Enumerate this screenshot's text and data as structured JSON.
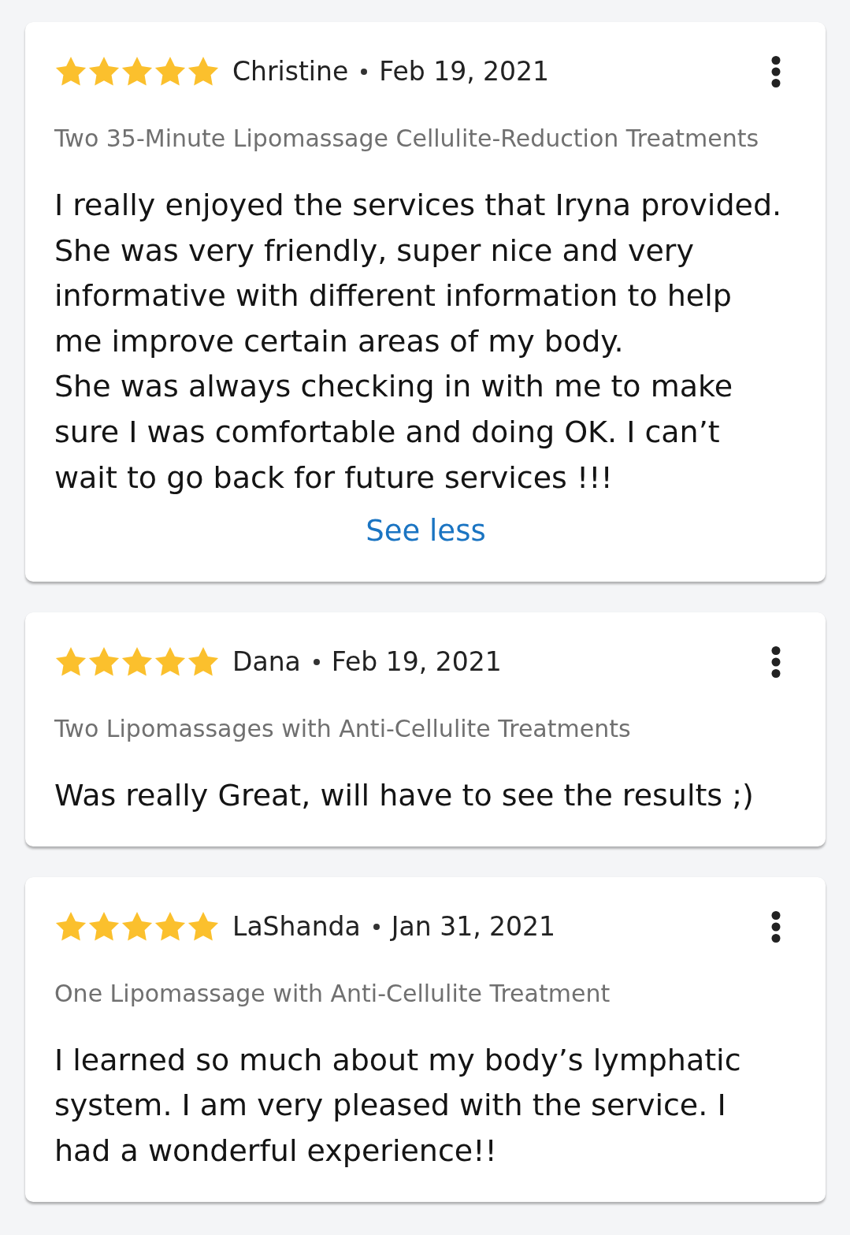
{
  "reviews": [
    {
      "stars": 5,
      "author": "Christine",
      "date": "Feb 19, 2021",
      "service": "Two 35-Minute Lipomassage Cellulite-Reduction Treatments",
      "text": "I really enjoyed the services that Iryna provided. She was very friendly, super nice and very informative with different information to help me improve certain areas of my body.\nShe was always checking in with me to make sure I was comfortable and doing OK. I can’t wait to go back for future services !!!",
      "toggle_link": "See less"
    },
    {
      "stars": 5,
      "author": "Dana",
      "date": "Feb 19, 2021",
      "service": "Two Lipomassages with Anti-Cellulite Treatments",
      "text": "Was really Great, will have to see the results ;)"
    },
    {
      "stars": 5,
      "author": "LaShanda",
      "date": "Jan 31, 2021",
      "service": "One Lipomassage with Anti-Cellulite Treatment",
      "text": "I learned so much about my body’s lymphatic system. I am very pleased with the service. I had a wonderful experience!!"
    }
  ]
}
